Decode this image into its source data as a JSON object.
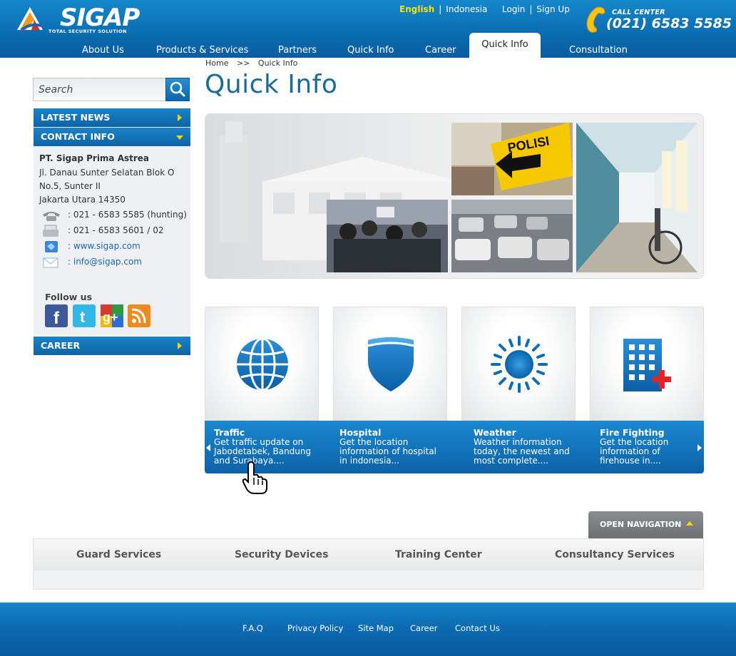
{
  "header": {
    "logo_text": "SIGAP",
    "logo_tagline": "TOTAL SECURITY SOLUTION",
    "lang_english": "English",
    "lang_indonesia": "Indonesia",
    "login": "Login",
    "signup": "Sign Up",
    "separator": "|",
    "call_center_label": "CALL CENTER",
    "call_center_number": "(021) 6583 5585"
  },
  "nav": {
    "items": [
      "About Us",
      "Products & Services",
      "Partners",
      "Quick Info",
      "Career",
      "Quick Info",
      "Consultation"
    ]
  },
  "breadcrumb": {
    "home": "Home",
    "sep": ">>",
    "current": "Quick Info"
  },
  "page_title": "Quick Info",
  "sidebar": {
    "search_placeholder": "Search",
    "menu": [
      "LATEST NEWS",
      "CONTACT INFO",
      "CAREER"
    ],
    "contact": {
      "company": "PT. Sigap Prima Astrea",
      "address": [
        "Jl. Danau Sunter Selatan Blok O",
        "No.5, Sunter II",
        "Jakarta Utara 14350"
      ],
      "phone": ": 021 - 6583 5585 (hunting)",
      "fax": ": 021 - 6583 5601 / 02",
      "web": ": www.sigap.com",
      "email": ": info@sigap.com"
    },
    "follow_us": "Follow us",
    "social": [
      "facebook-icon",
      "twitter-icon",
      "google-plus-icon",
      "rss-icon"
    ]
  },
  "cards": [
    {
      "title": "Traffic",
      "desc": [
        "Get traffic update on",
        "Jabodetabek, Bandung",
        "and Surabaya...."
      ],
      "icon": "globe-icon"
    },
    {
      "title": "Hospital",
      "desc": [
        "Get the location",
        "information of hospital",
        "in indonesia..."
      ],
      "icon": "shield-icon"
    },
    {
      "title": "Weather",
      "desc": [
        "Weather information",
        "today, the newest and",
        "most complete...."
      ],
      "icon": "sun-icon"
    },
    {
      "title": "Fire Fighting",
      "desc": [
        "Get the location",
        "information of",
        "firehouse in...."
      ],
      "icon": "building-plus-icon"
    }
  ],
  "open_navigation": "OPEN NAVIGATION",
  "footnav": [
    "Guard Services",
    "Security Devices",
    "Training Center",
    "Consultancy Services"
  ],
  "footer": [
    "F.A.Q",
    "Privacy Policy",
    "Site Map",
    "Career",
    "Contact Us"
  ],
  "colors": {
    "brand_blue": "#0b6bb0",
    "accent_yellow": "#ffd400",
    "title_blue": "#1a6c96"
  }
}
